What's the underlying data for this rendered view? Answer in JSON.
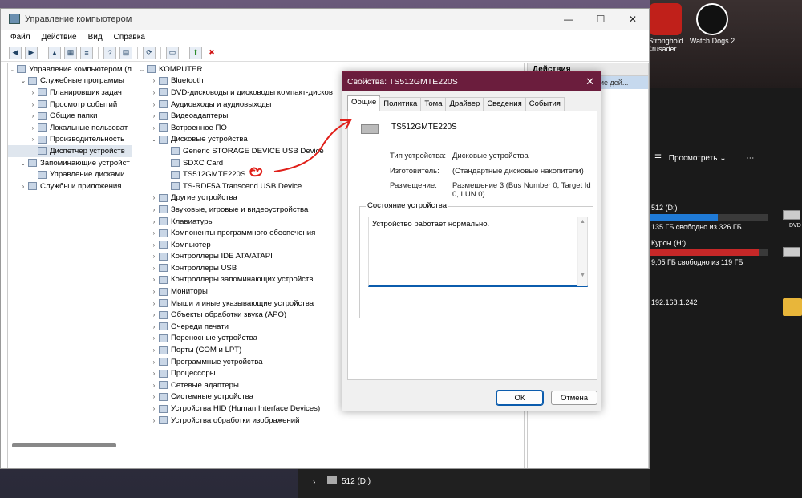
{
  "desktop": {
    "icons": [
      {
        "label": "Stronghold Crusader ...",
        "icon": "shield-icon",
        "color": "#c0201a"
      },
      {
        "label": "Watch Dogs 2",
        "icon": "game-icon",
        "color": "#111111"
      }
    ],
    "explorer": {
      "view_label": "Просмотреть",
      "drives": [
        {
          "name": "512 (D:)",
          "free": "135 ГБ свободно из 326 ГБ",
          "fill": 0.58,
          "color": "#1f7ad6"
        },
        {
          "name": "Курсы (H:)",
          "free": "9,05 ГБ свободно из 119 ГБ",
          "fill": 0.92,
          "color": "#c62828"
        }
      ],
      "network": "192.168.1.242",
      "dvd_label": "DVD"
    },
    "bottom_item": "512 (D:)"
  },
  "window": {
    "title": "Управление компьютером",
    "menu": [
      "Файл",
      "Действие",
      "Вид",
      "Справка"
    ],
    "left_tree": [
      {
        "label": "Управление компьютером (л",
        "level": 0,
        "arrow": "⌄"
      },
      {
        "label": "Служебные программы",
        "level": 1,
        "arrow": "⌄"
      },
      {
        "label": "Планировщик задач",
        "level": 2,
        "arrow": "›"
      },
      {
        "label": "Просмотр событий",
        "level": 2,
        "arrow": "›"
      },
      {
        "label": "Общие папки",
        "level": 2,
        "arrow": "›"
      },
      {
        "label": "Локальные пользоват",
        "level": 2,
        "arrow": "›"
      },
      {
        "label": "Производительность",
        "level": 2,
        "arrow": "›"
      },
      {
        "label": "Диспетчер устройств",
        "level": 2,
        "arrow": "",
        "selected": true
      },
      {
        "label": "Запоминающие устройст",
        "level": 1,
        "arrow": "⌄"
      },
      {
        "label": "Управление дисками",
        "level": 2,
        "arrow": ""
      },
      {
        "label": "Службы и приложения",
        "level": 1,
        "arrow": "›"
      }
    ],
    "device_tree": [
      {
        "label": "KOMPUTER",
        "level": 0,
        "arrow": "⌄"
      },
      {
        "label": "Bluetooth",
        "level": 1,
        "arrow": "›"
      },
      {
        "label": "DVD-дисководы и дисководы компакт-дисков",
        "level": 1,
        "arrow": "›"
      },
      {
        "label": "Аудиовходы и аудиовыходы",
        "level": 1,
        "arrow": "›"
      },
      {
        "label": "Видеоадаптеры",
        "level": 1,
        "arrow": "›"
      },
      {
        "label": "Встроенное ПО",
        "level": 1,
        "arrow": "›"
      },
      {
        "label": "Дисковые устройства",
        "level": 1,
        "arrow": "⌄"
      },
      {
        "label": "Generic STORAGE DEVICE USB Device",
        "level": 2,
        "arrow": ""
      },
      {
        "label": "SDXC Card",
        "level": 2,
        "arrow": ""
      },
      {
        "label": "TS512GMTE220S",
        "level": 2,
        "arrow": ""
      },
      {
        "label": "TS-RDF5A Transcend USB Device",
        "level": 2,
        "arrow": ""
      },
      {
        "label": "Другие устройства",
        "level": 1,
        "arrow": "›"
      },
      {
        "label": "Звуковые, игровые и видеоустройства",
        "level": 1,
        "arrow": "›"
      },
      {
        "label": "Клавиатуры",
        "level": 1,
        "arrow": "›"
      },
      {
        "label": "Компоненты программного обеспечения",
        "level": 1,
        "arrow": "›"
      },
      {
        "label": "Компьютер",
        "level": 1,
        "arrow": "›"
      },
      {
        "label": "Контроллеры IDE ATA/ATAPI",
        "level": 1,
        "arrow": "›"
      },
      {
        "label": "Контроллеры USB",
        "level": 1,
        "arrow": "›"
      },
      {
        "label": "Контроллеры запоминающих устройств",
        "level": 1,
        "arrow": "›"
      },
      {
        "label": "Мониторы",
        "level": 1,
        "arrow": "›"
      },
      {
        "label": "Мыши и иные указывающие устройства",
        "level": 1,
        "arrow": "›"
      },
      {
        "label": "Объекты обработки звука (APO)",
        "level": 1,
        "arrow": "›"
      },
      {
        "label": "Очереди печати",
        "level": 1,
        "arrow": "›"
      },
      {
        "label": "Переносные устройства",
        "level": 1,
        "arrow": "›"
      },
      {
        "label": "Порты (COM и LPT)",
        "level": 1,
        "arrow": "›"
      },
      {
        "label": "Программные устройства",
        "level": 1,
        "arrow": "›"
      },
      {
        "label": "Процессоры",
        "level": 1,
        "arrow": "›"
      },
      {
        "label": "Сетевые адаптеры",
        "level": 1,
        "arrow": "›"
      },
      {
        "label": "Системные устройства",
        "level": 1,
        "arrow": "›"
      },
      {
        "label": "Устройства HID (Human Interface Devices)",
        "level": 1,
        "arrow": "›"
      },
      {
        "label": "Устройства обработки изображений",
        "level": 1,
        "arrow": "›"
      }
    ],
    "actions": {
      "header": "Действия",
      "sub": "ие дей..."
    }
  },
  "dialog": {
    "title": "Свойства: TS512GMTE220S",
    "tabs": [
      "Общие",
      "Политика",
      "Тома",
      "Драйвер",
      "Сведения",
      "События"
    ],
    "device_name": "TS512GMTE220S",
    "fields": [
      {
        "label": "Тип устройства:",
        "value": "Дисковые устройства"
      },
      {
        "label": "Изготовитель:",
        "value": "(Стандартные дисковые накопители)"
      },
      {
        "label": "Размещение:",
        "value": "Размещение 3 (Bus Number 0, Target Id 0, LUN 0)"
      }
    ],
    "status_group": "Состояние устройства",
    "status_text": "Устройство работает нормально.",
    "ok": "ОК",
    "cancel": "Отмена"
  },
  "colors": {
    "dialog_title": "#6b1d3d",
    "annotation": "#e0201a",
    "accent": "#0b5cad"
  }
}
